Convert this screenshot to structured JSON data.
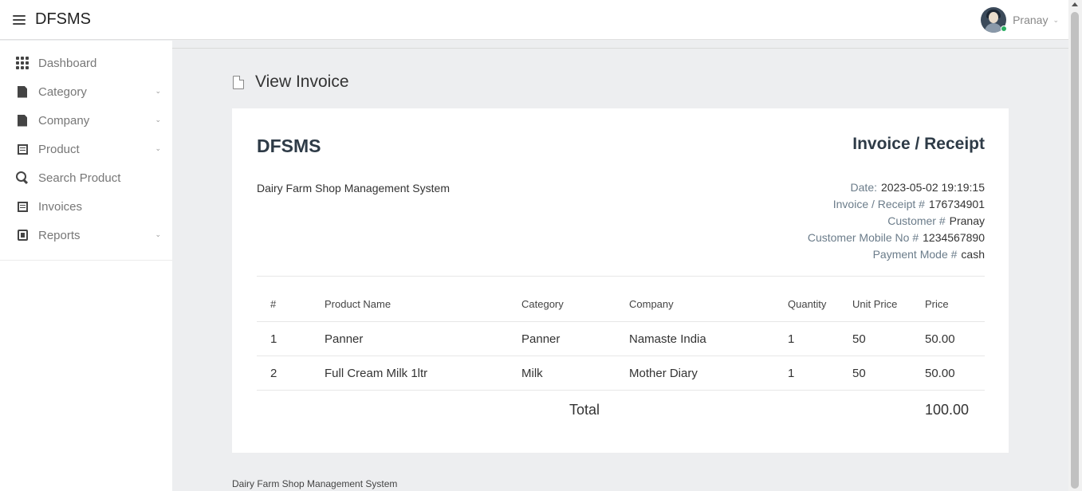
{
  "app": {
    "brand": "DFSMS"
  },
  "header": {
    "user_name": "Pranay"
  },
  "sidebar": {
    "items": [
      {
        "label": "Dashboard",
        "icon": "grid-icon",
        "has_caret": false
      },
      {
        "label": "Category",
        "icon": "document-icon",
        "has_caret": true
      },
      {
        "label": "Company",
        "icon": "document-icon",
        "has_caret": true
      },
      {
        "label": "Product",
        "icon": "list-icon",
        "has_caret": true
      },
      {
        "label": "Search Product",
        "icon": "search-icon",
        "has_caret": false
      },
      {
        "label": "Invoices",
        "icon": "list-icon",
        "has_caret": false
      },
      {
        "label": "Reports",
        "icon": "report-icon",
        "has_caret": true
      }
    ]
  },
  "page": {
    "title": "View Invoice",
    "icon": "page-icon"
  },
  "invoice": {
    "brand": "DFSMS",
    "heading": "Invoice / Receipt",
    "subtitle": "Dairy Farm Shop Management System",
    "meta": [
      {
        "label": "Date:",
        "value": "2023-05-02 19:19:15"
      },
      {
        "label": "Invoice / Receipt #",
        "value": "176734901"
      },
      {
        "label": "Customer #",
        "value": "Pranay"
      },
      {
        "label": "Customer Mobile No #",
        "value": "1234567890"
      },
      {
        "label": "Payment Mode #",
        "value": "cash"
      }
    ],
    "columns": [
      "#",
      "Product Name",
      "Category",
      "Company",
      "Quantity",
      "Unit Price",
      "Price"
    ],
    "rows": [
      [
        "1",
        "Panner",
        "Panner",
        "Namaste India",
        "1",
        "50",
        "50.00"
      ],
      [
        "2",
        "Full Cream Milk 1ltr",
        "Milk",
        "Mother Diary",
        "1",
        "50",
        "50.00"
      ]
    ],
    "total_label": "Total",
    "total_value": "100.00"
  },
  "footer": {
    "text": "Dairy Farm Shop Management System"
  },
  "colors": {
    "accent": "#2e3b47",
    "muted": "#6b7c8a",
    "online": "#27ae60",
    "background": "#edeef0"
  }
}
